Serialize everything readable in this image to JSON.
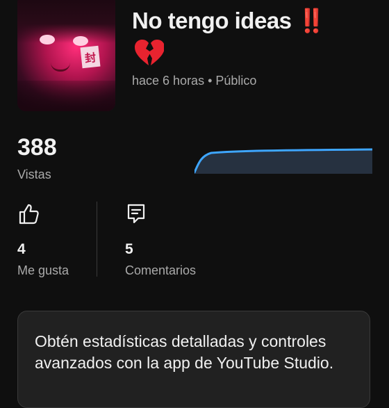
{
  "video": {
    "title": "No tengo ideas",
    "title_emoji_1": "‼️",
    "title_emoji_2": "💔",
    "meta": "hace 6 horas • Público"
  },
  "views": {
    "count": "388",
    "label": "Vistas",
    "line_color": "#3ea6ff"
  },
  "engagement": {
    "likes": {
      "count": "4",
      "label": "Me gusta",
      "icon": "thumbs-up-icon"
    },
    "comments": {
      "count": "5",
      "label": "Comentarios",
      "icon": "comment-icon"
    }
  },
  "promo": {
    "text": "Obtén estadísticas detalladas y controles avanzados con la app de YouTube Studio."
  }
}
